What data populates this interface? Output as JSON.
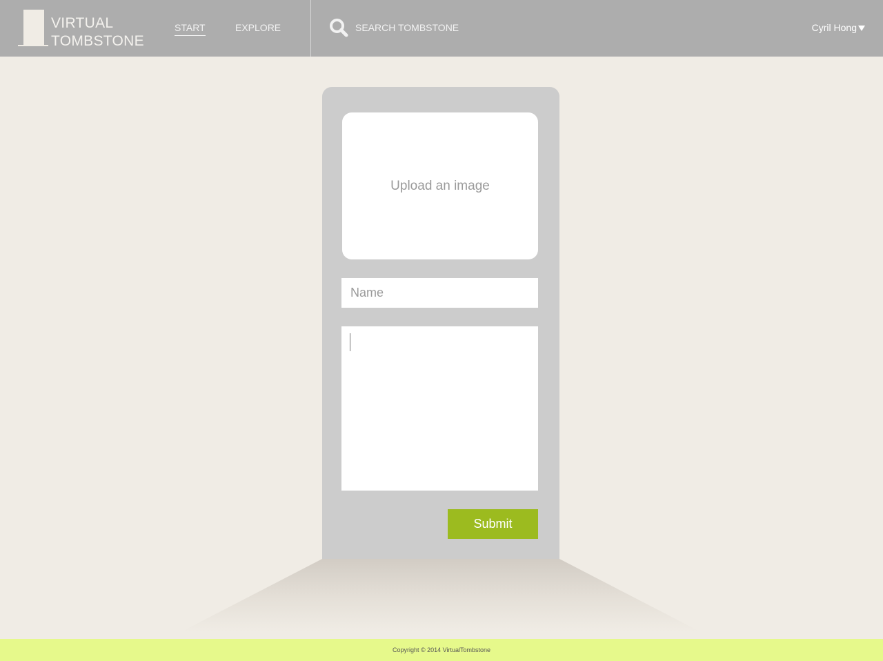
{
  "header": {
    "logo_line1": "VIRTUAL",
    "logo_line2": "TOMBSTONE",
    "nav": [
      {
        "label": "START",
        "active": true
      },
      {
        "label": "EXPLORE",
        "active": false
      }
    ],
    "search": {
      "placeholder": "SEARCH TOMBSTONE",
      "value": "",
      "icon": "search-icon"
    },
    "user": {
      "name": "Cyril Hong",
      "icon": "caret-down-icon"
    }
  },
  "form": {
    "upload_label": "Upload an image",
    "name_placeholder": "Name",
    "name_value": "",
    "description_value": "",
    "submit_label": "Submit"
  },
  "footer": {
    "copyright": "Copyright © 2014 VirtualTombstone"
  },
  "colors": {
    "header_bg": "#adadad",
    "page_bg": "#f0ece5",
    "stone": "#cccccc",
    "accent": "#9cbb1f",
    "footer_bg": "#e6f98b"
  }
}
